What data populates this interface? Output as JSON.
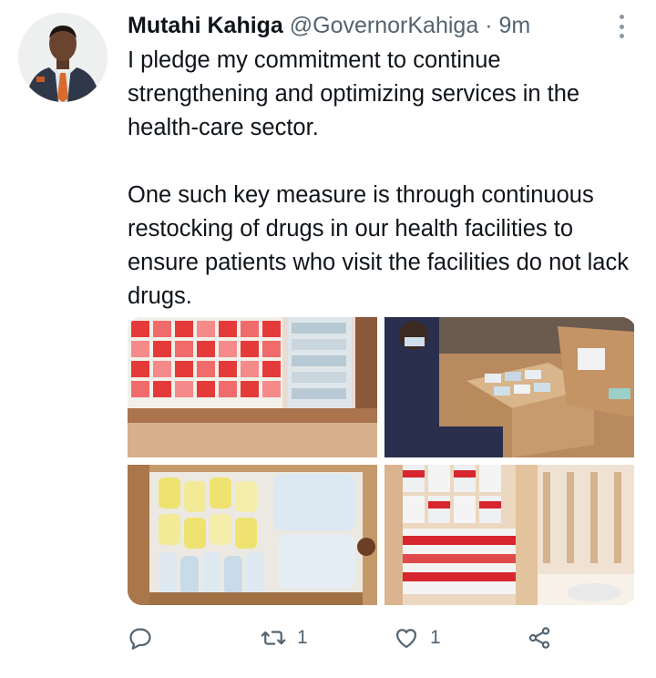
{
  "tweet": {
    "author_name": "Mutahi Kahiga",
    "handle": "@GovernorKahiga",
    "separator": "·",
    "time": "9m",
    "paragraphs": [
      "I pledge my commitment to continue strengthening and optimizing services in the health-care sector.",
      "One such key measure is through continuous restocking of drugs in our health facilities to ensure patients who visit the facilities do not lack drugs."
    ]
  },
  "media": {
    "photos": [
      "drug-shelves-photo",
      "boxes-unpacking-photo",
      "bagged-supplies-photo",
      "stacked-cartons-photo"
    ]
  },
  "actions": {
    "reply_icon": "reply-icon",
    "retweet_icon": "retweet-icon",
    "retweet_count": "1",
    "like_icon": "heart-icon",
    "like_count": "1",
    "share_icon": "share-icon"
  },
  "colors": {
    "primary_text": "#0f1419",
    "secondary_text": "#536471"
  }
}
